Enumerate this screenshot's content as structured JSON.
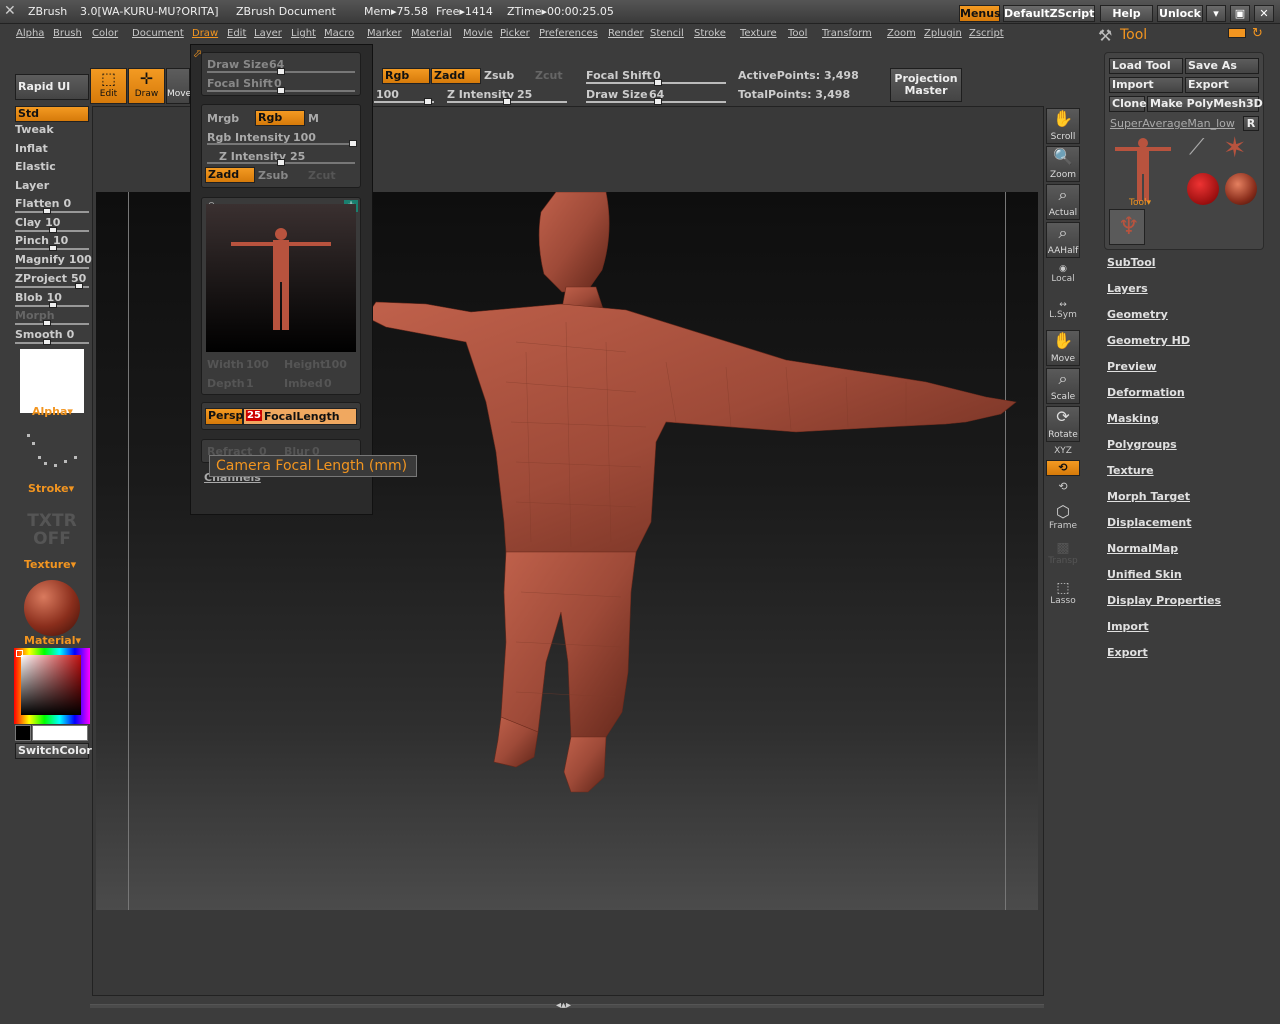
{
  "titlebar": {
    "app": "ZBrush",
    "version": "3.0[WA-KURU-MU?ORITA]",
    "doc": "ZBrush Document",
    "mem": "Mem▸75.58",
    "free": "Free▸1414",
    "ztime": "ZTime▸00:00:25.05",
    "buttons": [
      "Menus",
      "DefaultZScript",
      "Help",
      "Unlock"
    ]
  },
  "menubar": [
    "Alpha",
    "Brush",
    "Color",
    "Document",
    "Draw",
    "Edit",
    "Layer",
    "Light",
    "Macro",
    "Marker",
    "Material",
    "Movie",
    "Picker",
    "Preferences",
    "Render",
    "Stencil",
    "Stroke",
    "Texture",
    "Tool",
    "Transform",
    "Zoom",
    "Zplugin",
    "Zscript"
  ],
  "topshelf": {
    "rapid_ui": "Rapid UI",
    "edit": "Edit",
    "draw": "Draw",
    "move": "Move",
    "rgb": "Rgb",
    "zadd": "Zadd",
    "zsub": "Zsub",
    "zcut": "Zcut",
    "focal_shift": "Focal Shift",
    "focal_shift_val": "0",
    "draw_size": "Draw Size",
    "draw_size_val": "64",
    "z_intensity": "Z Intensity",
    "z_intensity_val": "25",
    "rgb_int_val": "100",
    "active_points": "ActivePoints: 3,498",
    "total_points": "TotalPoints: 3,498",
    "projection_master": [
      "Projection",
      "Master"
    ]
  },
  "leftshelf": {
    "brushes": [
      "Std",
      "Tweak",
      "Inflat",
      "Elastic",
      "Layer"
    ],
    "sliders": [
      {
        "label": "Flatten",
        "val": "0",
        "fill": 0.0
      },
      {
        "label": "Clay",
        "val": "10",
        "fill": 0.1
      },
      {
        "label": "Pinch",
        "val": "10",
        "fill": 0.1
      },
      {
        "label": "Magnify",
        "val": "100",
        "fill": 1.0
      },
      {
        "label": "ZProject",
        "val": "50",
        "fill": 0.5
      },
      {
        "label": "Blob",
        "val": "10",
        "fill": 0.1
      },
      {
        "label": "Morph",
        "val": "",
        "fill": 0.0
      },
      {
        "label": "Smooth",
        "val": "0",
        "fill": 0.0
      }
    ],
    "alpha": "Alpha",
    "stroke": "Stroke",
    "txtr": "TXTR",
    "off": "OFF",
    "texture": "Texture",
    "material": "Material",
    "switchcolor": "SwitchColor"
  },
  "dropdown": {
    "draw_size": "Draw Size",
    "draw_size_val": "64",
    "focal_shift": "Focal Shift",
    "focal_shift_val": "0",
    "mrgb": "Mrgb",
    "rgb": "Rgb",
    "m": "M",
    "rgb_intensity": "Rgb Intensity",
    "rgb_intensity_val": "100",
    "z_intensity": "Z Intensity",
    "z_intensity_val": "25",
    "zadd": "Zadd",
    "zsub": "Zsub",
    "zcut": "Zcut",
    "width": "Width",
    "width_val": "100",
    "height": "Height",
    "height_val": "100",
    "depth": "Depth",
    "depth_val": "1",
    "imbed": "Imbed",
    "imbed_val": "0",
    "persp": "Persp",
    "focal_val": "25",
    "focal_length": "FocalLength",
    "refract": "Refract",
    "refract_val": "0",
    "blur": "Blur",
    "blur_val": "0",
    "channels": "Channels"
  },
  "tooltip": "Camera Focal Length (mm)",
  "rightshelf": [
    "Scroll",
    "Zoom",
    "Actual",
    "AAHalf",
    "Local",
    "L.Sym",
    "Move",
    "Scale",
    "Rotate",
    "XYZ",
    "Frame",
    "Transp",
    "Lasso"
  ],
  "toolpanel": {
    "title": "Tool",
    "buttons": [
      "Load Tool",
      "Save As",
      "Import",
      "Export",
      "Clone",
      "Make PolyMesh3D"
    ],
    "r": "R",
    "current_tool": "SuperAverageMan_low",
    "tool_label": "Tool",
    "links": [
      "SubTool",
      "Layers",
      "Geometry",
      "Geometry HD",
      "Preview",
      "Deformation",
      "Masking",
      "Polygroups",
      "Texture",
      "Morph Target",
      "Displacement",
      "NormalMap",
      "Unified Skin",
      "Display Properties",
      "Import",
      "Export"
    ]
  },
  "colors": {
    "accent": "#f29520",
    "panel": "#3c3c3c",
    "skin": "#9e4a38"
  }
}
